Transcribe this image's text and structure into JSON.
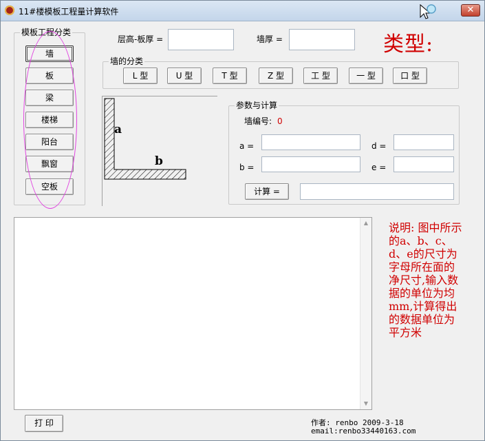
{
  "window": {
    "title": "11#楼模板工程量计算软件",
    "close_label": "✕"
  },
  "category_group": {
    "label": "模板工程分类",
    "items": [
      "墙",
      "板",
      "梁",
      "楼梯",
      "阳台",
      "飘窗",
      "空板"
    ],
    "selected": "墙"
  },
  "top_fields": {
    "floor_label": "层高-板厚 =",
    "floor_value": "",
    "wall_thickness_label": "墙厚 =",
    "wall_thickness_value": ""
  },
  "type_title": "类型:",
  "wall_types": {
    "label": "墙的分类",
    "items": [
      "L 型",
      "U 型",
      "T 型",
      "Z 型",
      "工 型",
      "一 型",
      "口 型"
    ]
  },
  "diagram": {
    "label_a": "a",
    "label_b": "b"
  },
  "params": {
    "label": "参数与计算",
    "wall_no_label": "墙编号:",
    "wall_no_value": "0",
    "fields": [
      {
        "label": "a =",
        "value": ""
      },
      {
        "label": "d =",
        "value": ""
      },
      {
        "label": "b =",
        "value": ""
      },
      {
        "label": "e =",
        "value": ""
      }
    ],
    "calc_label": "计算 =",
    "result_value": ""
  },
  "output_text": "",
  "note": "说明: 图中所示的a、b、c、d、e的尺寸为字母所在面的净尺寸,输入数据的单位为均mm,计算得出的数据单位为平方米",
  "print_label": "打 印",
  "author": {
    "line1": "作者: renbo 2009-3-18",
    "line2": "email:renbo33440163.com"
  },
  "colors": {
    "accent_red": "#d00000",
    "highlight": "#e040e0"
  }
}
